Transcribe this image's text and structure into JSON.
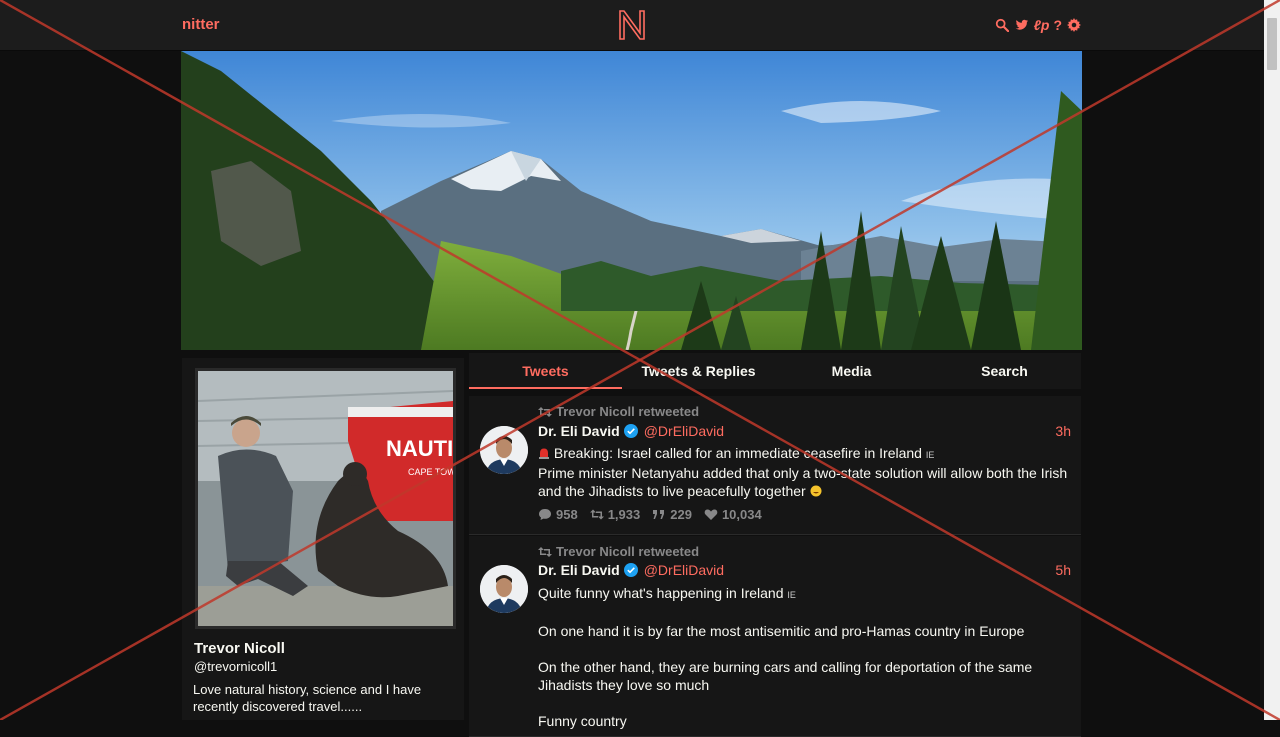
{
  "nav": {
    "brand": "nitter",
    "logo_letter": "N",
    "icons": [
      "search-icon",
      "twitter-bird-icon",
      "rss-icon",
      "help-icon",
      "gear-icon"
    ],
    "rss_glyph": "ℓp",
    "help_glyph": "?"
  },
  "colors": {
    "accent": "#ff6c60",
    "background": "#0f0f0f",
    "panel": "#161616",
    "navbar": "#1c1c1c",
    "muted": "#888889",
    "verified": "#1da1f2",
    "overlay": "#c0392b"
  },
  "profile": {
    "fullname": "Trevor Nicoll",
    "username": "@trevornicoll1",
    "bio": "Love natural history, science and I have recently discovered travel......",
    "boat_text": "NAUTIC",
    "boat_subtext": "CAPE TOWN"
  },
  "tabs": [
    {
      "label": "Tweets",
      "active": true
    },
    {
      "label": "Tweets & Replies",
      "active": false
    },
    {
      "label": "Media",
      "active": false
    },
    {
      "label": "Search",
      "active": false
    }
  ],
  "tweets": [
    {
      "retweet_header": "Trevor Nicoll retweeted",
      "fullname": "Dr. Eli David",
      "username": "@DrEliDavid",
      "date": "3h",
      "lines": [
        "Breaking: Israel called for an immediate ceasefire in Ireland",
        "Prime minister Netanyahu added that only a two-state solution will allow both the Irish and the Jihadists to live peacefully together"
      ],
      "flag_glyph": "IE",
      "stats": {
        "replies": "958",
        "retweets": "1,933",
        "quotes": "229",
        "likes": "10,034"
      }
    },
    {
      "retweet_header": "Trevor Nicoll retweeted",
      "fullname": "Dr. Eli David",
      "username": "@DrEliDavid",
      "date": "5h",
      "paragraphs": [
        "Quite funny what's happening in Ireland",
        "On one hand it is by far the most antisemitic and pro-Hamas country in Europe",
        "On the other hand, they are burning cars and calling for deportation of the same Jihadists they love so much",
        "Funny country"
      ],
      "flag_glyph": "IE"
    }
  ]
}
